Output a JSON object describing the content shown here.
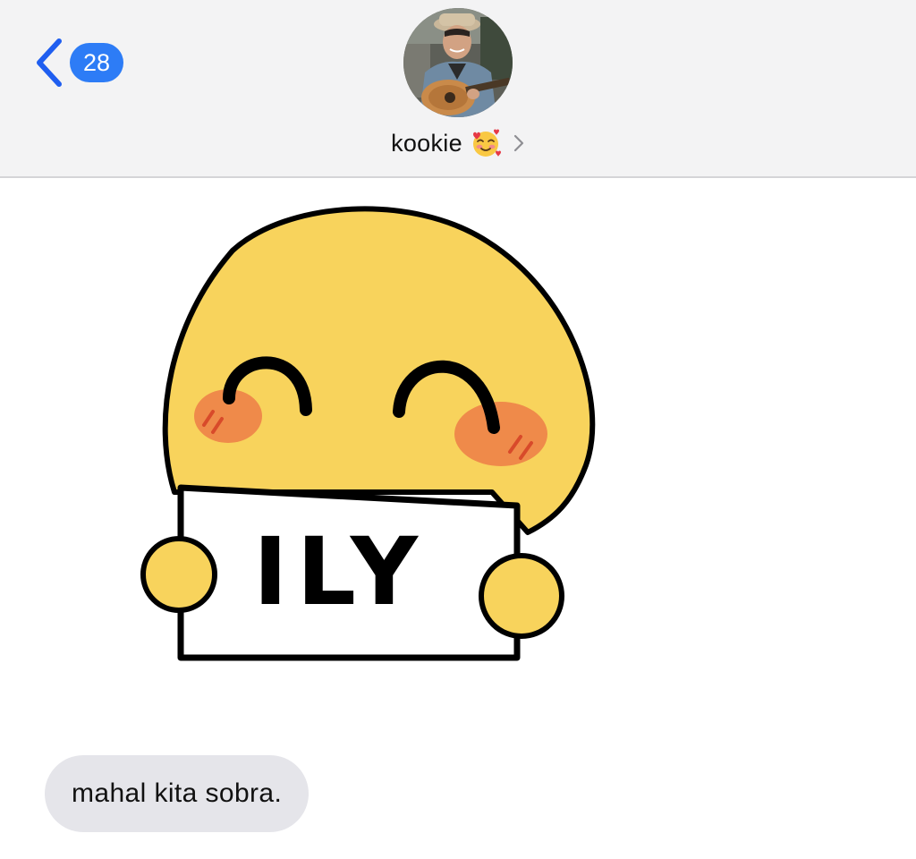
{
  "header": {
    "unread_count": "28",
    "contact_name": "kookie",
    "contact_emoji": "smiling-face-with-hearts-icon"
  },
  "sticker": {
    "sign_text": "ILY"
  },
  "messages": [
    {
      "direction": "incoming",
      "text": "mahal kita sobra."
    }
  ],
  "colors": {
    "accent": "#2d7cf6",
    "nav_background": "#f3f3f4",
    "bubble_incoming": "#e5e5ea",
    "sticker_face": "#f8d35c",
    "sticker_blush": "#ef8a4a"
  }
}
